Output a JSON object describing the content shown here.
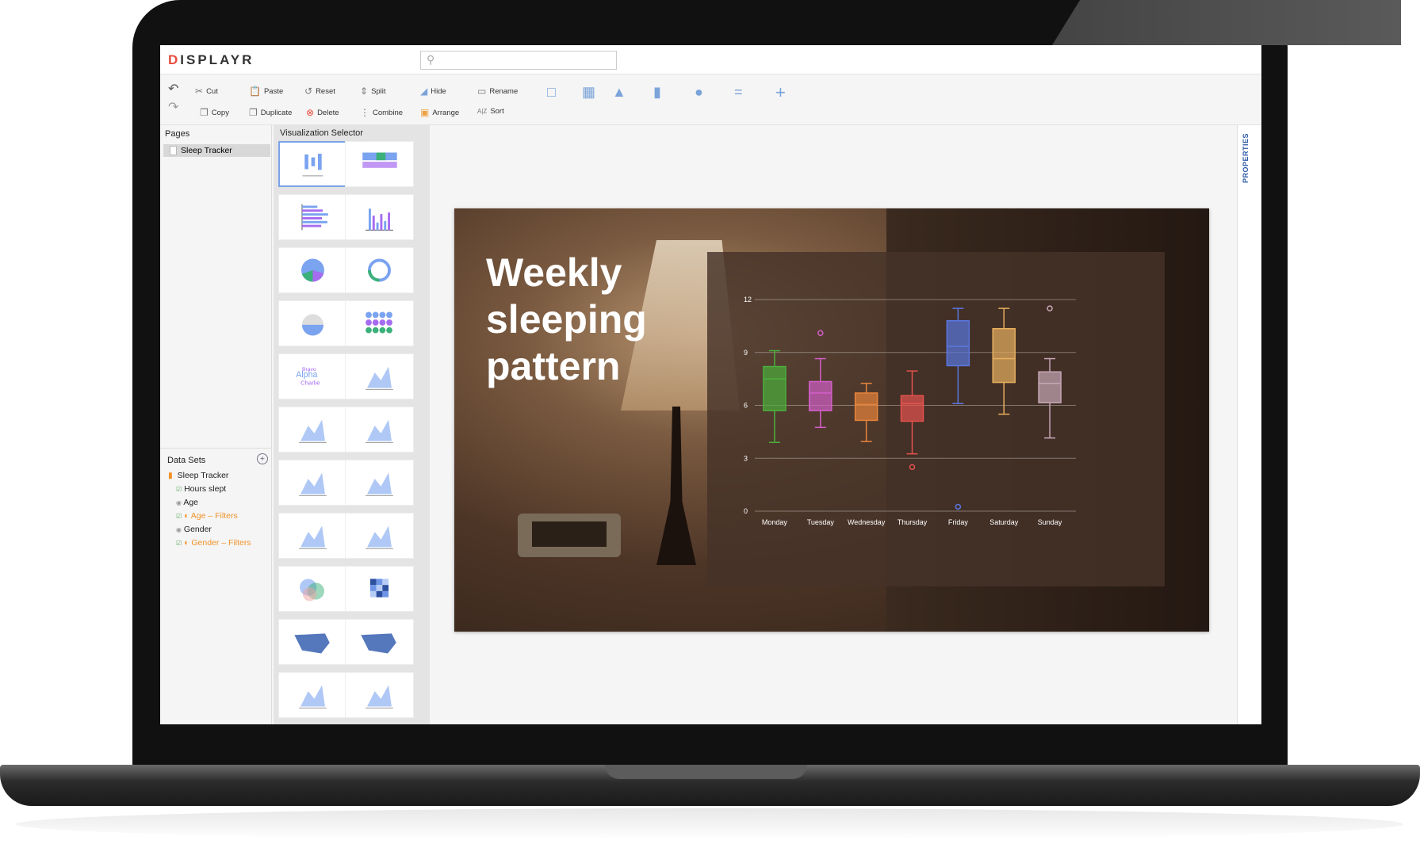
{
  "app": {
    "logo": "DISPLAYR",
    "search": {
      "placeholder": ""
    }
  },
  "toolbar": {
    "row1": [
      "Cut",
      "Paste",
      "Reset",
      "Split",
      "Hide",
      "Rename"
    ],
    "row2": [
      "Copy",
      "Duplicate",
      "Delete",
      "Combine",
      "Arrange",
      "Sort"
    ],
    "icons": [
      "undo-icon",
      "redo-icon",
      "text-box-icon",
      "table-icon",
      "image-icon",
      "chart-icon",
      "shape-icon",
      "line-icon",
      "plus-icon"
    ]
  },
  "pages": {
    "title": "Pages",
    "items": [
      {
        "label": "Sleep Tracker"
      }
    ]
  },
  "datasets": {
    "title": "Data Sets",
    "root": "Sleep Tracker",
    "items": [
      {
        "label": "Hours slept",
        "filter": false
      },
      {
        "label": "Age",
        "filter": false
      },
      {
        "label": "Age – Filters",
        "filter": true
      },
      {
        "label": "Gender",
        "filter": false
      },
      {
        "label": "Gender – Filters",
        "filter": true
      }
    ]
  },
  "viz": {
    "title": "Visualization Selector",
    "selected": 0,
    "tiles": [
      "box-plot",
      "sankey",
      "bar",
      "column",
      "pie",
      "donut",
      "pictograph-apple",
      "pictograph",
      "word-cloud",
      "palm-tree",
      "bubble",
      "scatter",
      "radar",
      "histogram",
      "area",
      "line",
      "venn",
      "heatmap",
      "geo-map",
      "small-multiple-maps",
      "streamgraph",
      "density"
    ],
    "colors": {
      "blue": "#7aa3f0",
      "purple": "#a66cf0",
      "green": "#3bb07a"
    }
  },
  "properties_label": "PROPERTIES",
  "slide": {
    "title": "Weekly sleeping pattern"
  },
  "chart_data": {
    "type": "box",
    "categories": [
      "Monday",
      "Tuesday",
      "Wednesday",
      "Thursday",
      "Friday",
      "Saturday",
      "Sunday"
    ],
    "ylim": [
      0,
      12
    ],
    "yticks": [
      0,
      3,
      6,
      9,
      12
    ],
    "grid": true,
    "series": [
      {
        "min": 3.9,
        "q1": 5.7,
        "median": 7.5,
        "q3": 8.2,
        "max": 9.1,
        "outliers": [],
        "color": "#4caf3c"
      },
      {
        "min": 4.75,
        "q1": 5.7,
        "median": 6.7,
        "q3": 7.35,
        "max": 8.65,
        "outliers": [
          10.1
        ],
        "color": "#d35fc9"
      },
      {
        "min": 3.95,
        "q1": 5.15,
        "median": 6.05,
        "q3": 6.7,
        "max": 7.25,
        "outliers": [],
        "color": "#e8843a"
      },
      {
        "min": 3.25,
        "q1": 5.1,
        "median": 6.1,
        "q3": 6.55,
        "max": 7.95,
        "outliers": [
          2.5
        ],
        "color": "#e5534f"
      },
      {
        "min": 6.1,
        "q1": 8.25,
        "median": 9.35,
        "q3": 10.8,
        "max": 11.5,
        "outliers": [
          0.25
        ],
        "color": "#5a78e0"
      },
      {
        "min": 5.5,
        "q1": 7.3,
        "median": 8.65,
        "q3": 10.35,
        "max": 11.5,
        "outliers": [],
        "color": "#e8b060"
      },
      {
        "min": 4.15,
        "q1": 6.15,
        "median": 7.25,
        "q3": 7.9,
        "max": 8.65,
        "outliers": [
          11.5
        ],
        "color": "#c8a8b8"
      }
    ]
  }
}
